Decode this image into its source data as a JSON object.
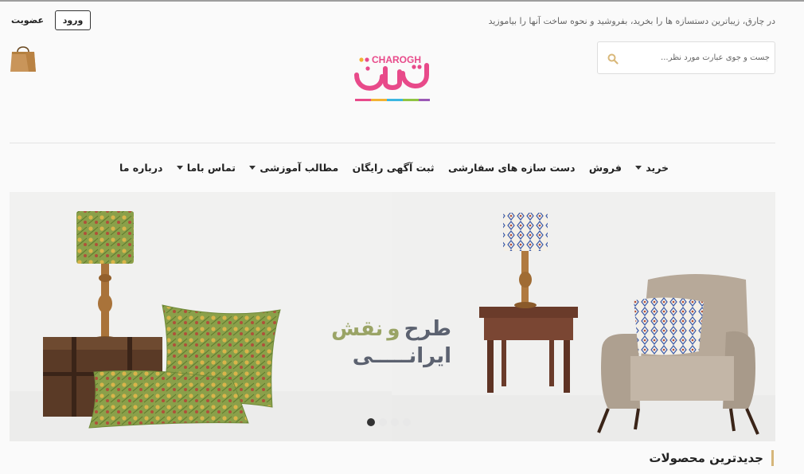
{
  "header": {
    "tagline": "در چارق، زیباترین دستسازه ها را بخرید، بفروشید و نحوه ساخت آنها را بیاموزید",
    "login_label": "ورود",
    "signup_label": "عضویت",
    "cart_icon": "shopping-bag-icon",
    "logo": {
      "latin": "CHAROGH",
      "persian": "چارق"
    }
  },
  "search": {
    "placeholder": "جست و جوی عبارت مورد نظر...",
    "value": "",
    "icon": "search-icon",
    "icon_color": "#d9b87a"
  },
  "nav": {
    "items": [
      {
        "label": "خرید",
        "has_dropdown": true
      },
      {
        "label": "فروش",
        "has_dropdown": false
      },
      {
        "label": "دست سازه های سفارشی",
        "has_dropdown": false
      },
      {
        "label": "ثبت آگهی رایگان",
        "has_dropdown": false
      },
      {
        "label": "مطالب آموزشی",
        "has_dropdown": true
      },
      {
        "label": "تماس باما",
        "has_dropdown": true
      },
      {
        "label": "درباره ما",
        "has_dropdown": false
      }
    ]
  },
  "banner": {
    "headline_line1_a": "طرح",
    "headline_line1_b": "و",
    "headline_line1_c": "نقش",
    "headline_line2": "ایرانـــــی",
    "slide_count": 4,
    "active_slide": 1
  },
  "sections": {
    "newest_title": "جدیدترین محصولات"
  },
  "colors": {
    "accent": "#d6b67a",
    "logo_pink": "#e84a8a",
    "headline_dark": "#5c6270",
    "headline_green": "#9aa466"
  }
}
